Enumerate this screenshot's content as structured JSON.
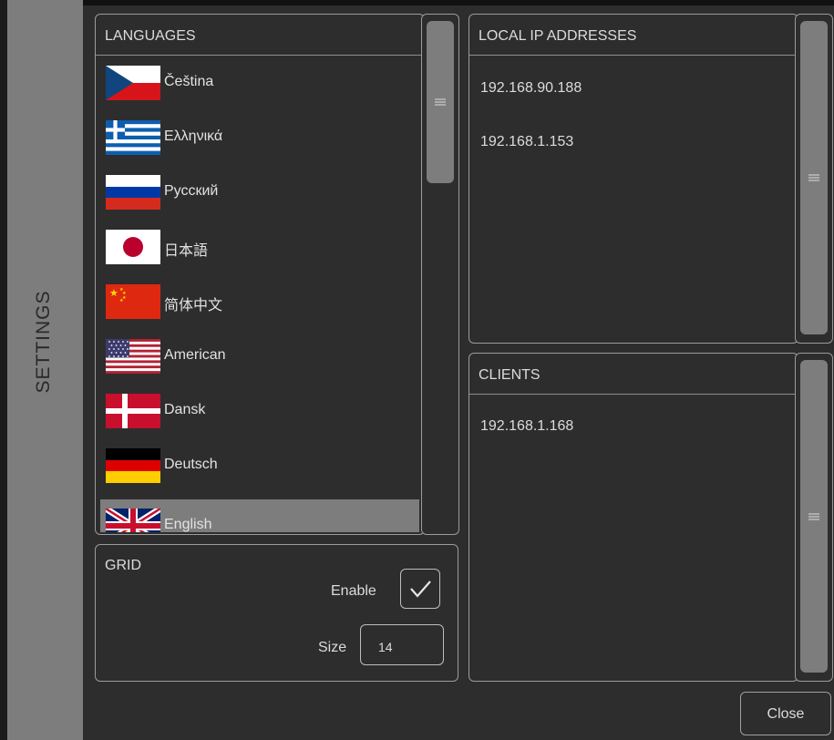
{
  "sidebar": {
    "title": "SETTINGS"
  },
  "languages": {
    "header": "LANGUAGES",
    "items": [
      {
        "label": "Čeština",
        "flag": "czech-flag"
      },
      {
        "label": "Ελληνικά",
        "flag": "greek-flag"
      },
      {
        "label": "Русский",
        "flag": "russian-flag"
      },
      {
        "label": "日本語",
        "flag": "japanese-flag"
      },
      {
        "label": "简体中文",
        "flag": "chinese-flag"
      },
      {
        "label": "American",
        "flag": "us-flag"
      },
      {
        "label": "Dansk",
        "flag": "danish-flag"
      },
      {
        "label": "Deutsch",
        "flag": "german-flag"
      },
      {
        "label": "English",
        "flag": "uk-flag",
        "selected": true
      }
    ]
  },
  "grid": {
    "header": "GRID",
    "enable_label": "Enable",
    "enabled": true,
    "size_label": "Size",
    "size_value": "14"
  },
  "local_ip": {
    "header": "LOCAL IP ADDRESSES",
    "items": [
      "192.168.90.188",
      "192.168.1.153"
    ]
  },
  "clients": {
    "header": "CLIENTS",
    "items": [
      "192.168.1.168"
    ]
  },
  "footer": {
    "close_label": "Close"
  },
  "colors": {
    "background": "#2d2d2d",
    "sidebar": "#7d7d7d",
    "border": "#9b9b9b",
    "selected": "#7d7d7d"
  }
}
